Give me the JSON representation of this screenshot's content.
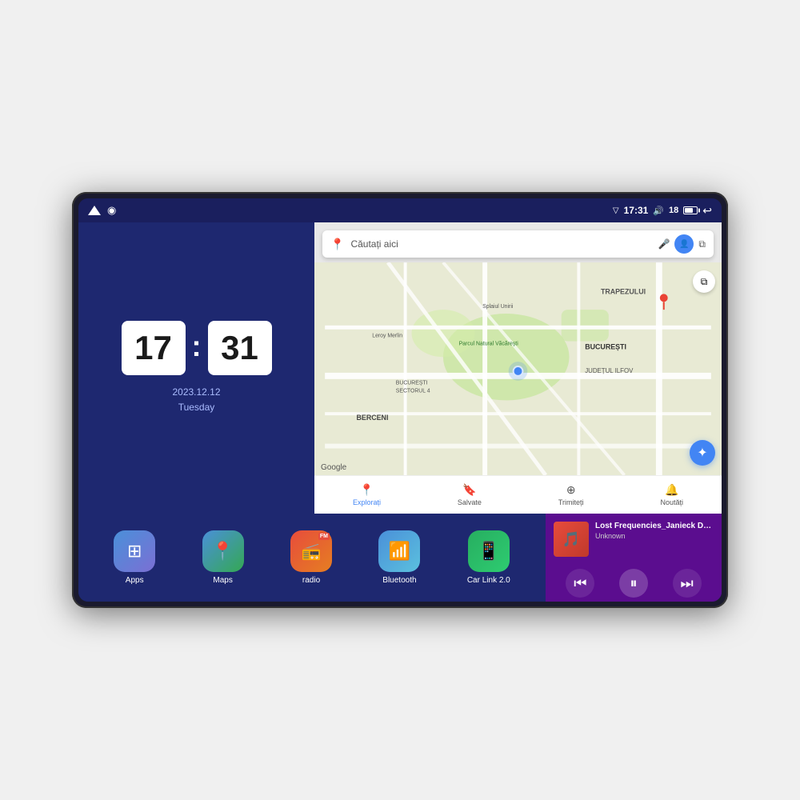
{
  "device": {
    "screen": {
      "status_bar": {
        "time": "17:31",
        "signal_bars": "18",
        "nav_triangle": "▽",
        "maps_indicator": "◉"
      },
      "clock": {
        "hours": "17",
        "minutes": "31",
        "date": "2023.12.12",
        "day": "Tuesday"
      },
      "map": {
        "search_placeholder": "Căutați aici",
        "bottom_items": [
          {
            "label": "Explorați",
            "icon": "📍",
            "active": true
          },
          {
            "label": "Salvate",
            "icon": "🔖",
            "active": false
          },
          {
            "label": "Trimiteți",
            "icon": "⊕",
            "active": false
          },
          {
            "label": "Noutăți",
            "icon": "🔔",
            "active": false
          }
        ],
        "labels": [
          "TRAPEZULUI",
          "BUCUREȘTI",
          "JUDEȚUL ILFOV",
          "BERCENI",
          "Parcul Natural Văcărești",
          "Leroy Merlin",
          "BUCUREȘTI SECTORUL 4",
          "Splaiul Unirii"
        ]
      },
      "apps": [
        {
          "id": "apps",
          "label": "Apps",
          "icon": "⊞",
          "icon_class": "icon-apps"
        },
        {
          "id": "maps",
          "label": "Maps",
          "icon": "📍",
          "icon_class": "icon-maps"
        },
        {
          "id": "radio",
          "label": "radio",
          "icon": "📻",
          "icon_class": "icon-radio",
          "badge": "FM"
        },
        {
          "id": "bluetooth",
          "label": "Bluetooth",
          "icon": "⬡",
          "icon_class": "icon-bluetooth"
        },
        {
          "id": "carlink",
          "label": "Car Link 2.0",
          "icon": "📱",
          "icon_class": "icon-carlink"
        }
      ],
      "music": {
        "title": "Lost Frequencies_Janieck Devy-...",
        "artist": "Unknown",
        "thumb_emoji": "🎵",
        "controls": {
          "prev": "⏮",
          "play": "⏸",
          "next": "⏭"
        }
      }
    }
  }
}
